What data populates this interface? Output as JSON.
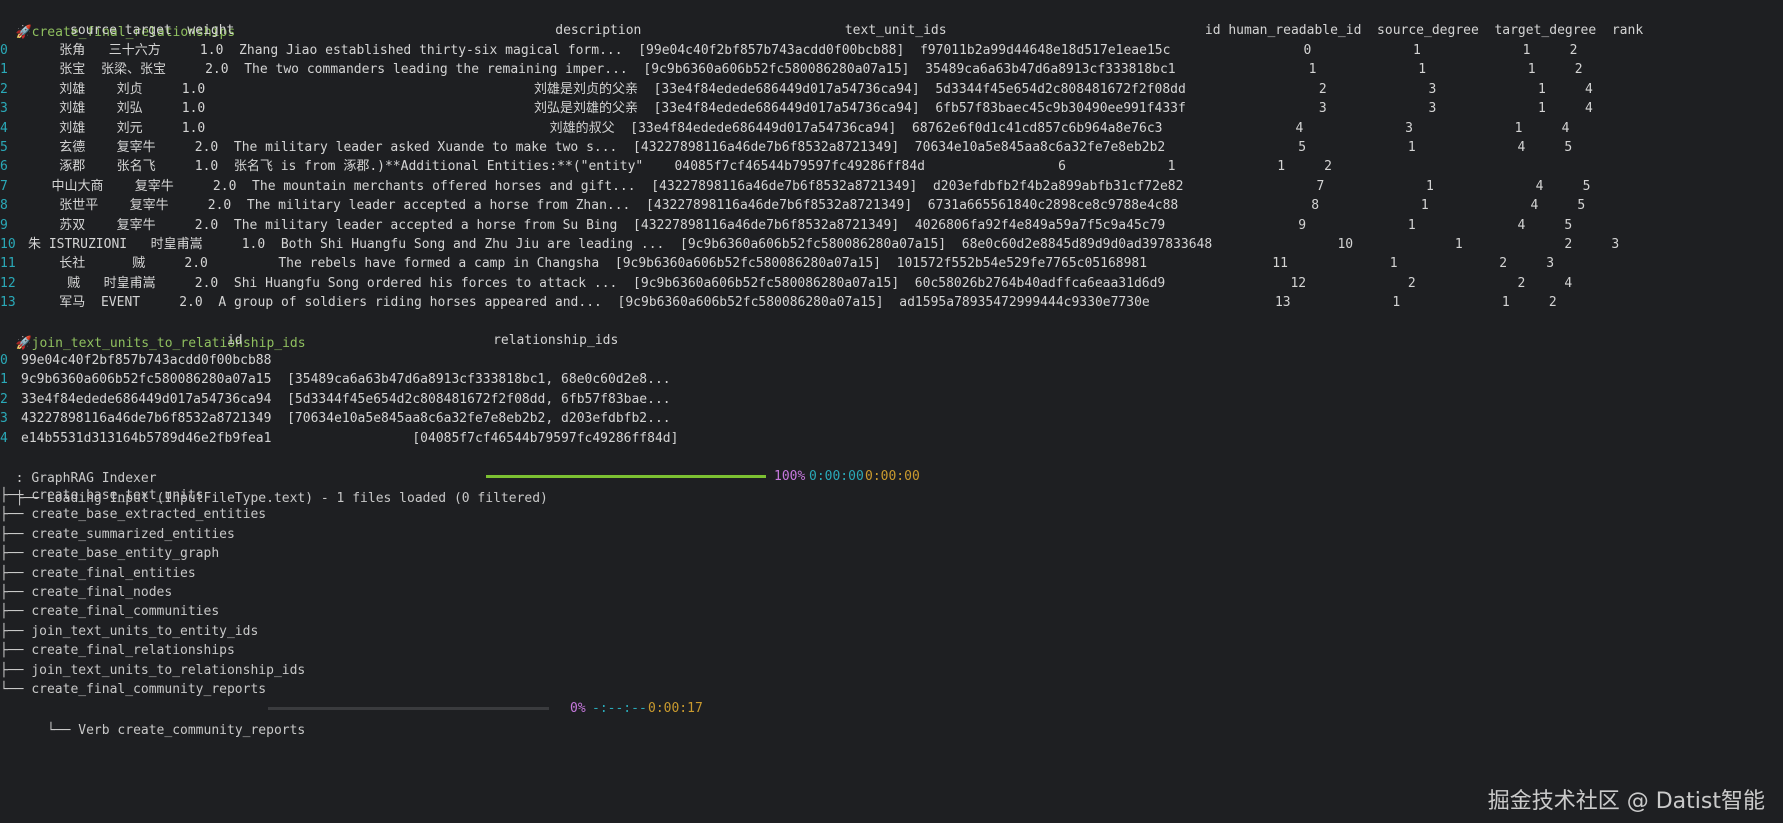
{
  "sections": {
    "relationships_title": "create_final_relationships",
    "relationships_header": "source target  weight                                         description                          text_unit_ids                                 id human_readable_id  source_degree  target_degree  rank",
    "relationship_rows": [
      {
        "idx": "0",
        "text": "    张角   三十六方     1.0  Zhang Jiao established thirty-six magical form...  [99e04c40f2bf857b743acdd0f00bcb88]  f97011b2a99d44648e18d517e1eae15c                 0             1             1     2"
      },
      {
        "idx": "1",
        "text": "    张宝  张梁、张宝     2.0  The two commanders leading the remaining imper...  [9c9b6360a606b52fc580086280a07a15]  35489ca6a63b47d6a8913cf333818bc1                 1             1             1     2"
      },
      {
        "idx": "2",
        "text": "    刘雄    刘贞     1.0                                          刘雄是刘贞的父亲  [33e4f84edede686449d017a54736ca94]  5d3344f45e654d2c808481672f2f08dd                 2             3             1     4"
      },
      {
        "idx": "3",
        "text": "    刘雄    刘弘     1.0                                          刘弘是刘雄的父亲  [33e4f84edede686449d017a54736ca94]  6fb57f83baec45c9b30490ee991f433f                 3             3             1     4"
      },
      {
        "idx": "4",
        "text": "    刘雄    刘元     1.0                                            刘雄的叔父  [33e4f84edede686449d017a54736ca94]  68762e6f0d1c41cd857c6b964a8e76c3                 4             3             1     4"
      },
      {
        "idx": "5",
        "text": "    玄德    复宰牛     2.0  The military leader asked Xuande to make two s...  [43227898116a46de7b6f8532a8721349]  70634e10a5e845aa8c6a32fe7e8eb2b2                 5             1             4     5"
      },
      {
        "idx": "6",
        "text": "    涿郡    张名飞     1.0  张名飞 is from 涿郡.)**Additional Entities:**(\"entity\"    04085f7cf46544b79597fc49286ff84d                 6             1             1     2"
      },
      {
        "idx": "7",
        "text": "   中山大商    复宰牛     2.0  The mountain merchants offered horses and gift...  [43227898116a46de7b6f8532a8721349]  d203efdbfb2f4b2a899abfb31cf72e82                 7             1             4     5"
      },
      {
        "idx": "8",
        "text": "    张世平    复宰牛     2.0  The military leader accepted a horse from Zhan...  [43227898116a46de7b6f8532a8721349]  6731a665561840c2898ce8c9788e4c88                 8             1             4     5"
      },
      {
        "idx": "9",
        "text": "    苏双    复宰牛     2.0  The military leader accepted a horse from Su Bing  [43227898116a46de7b6f8532a8721349]  4026806fa92f4e849a59a7f5c9a45c79                 9             1             4     5"
      },
      {
        "idx": "10",
        "text": "朱 ISTRUZIONI   时皇甫嵩     1.0  Both Shi Huangfu Song and Zhu Jiu are leading ...  [9c9b6360a606b52fc580086280a07a15]  68e0c60d2e8845d89d9d0ad397833648                10             1             2     3"
      },
      {
        "idx": "11",
        "text": "    长社      贼     2.0         The rebels have formed a camp in Changsha  [9c9b6360a606b52fc580086280a07a15]  101572f552b54e529fe7765c05168981                11             1             2     3"
      },
      {
        "idx": "12",
        "text": "     贼   时皇甫嵩     2.0  Shi Huangfu Song ordered his forces to attack ...  [9c9b6360a606b52fc580086280a07a15]  60c58026b2764b40adffca6eaa31d6d9                12             2             2     4"
      },
      {
        "idx": "13",
        "text": "    军马  EVENT     2.0  A group of soldiers riding horses appeared and...  [9c9b6360a606b52fc580086280a07a15]  ad1595a78935472999444c9330e7730e                13             1             1     2"
      }
    ],
    "join_title": "join_text_units_to_relationship_ids",
    "join_header": "                             id                                relationship_ids",
    "join_rows": [
      {
        "idx": "0",
        "text": "99e04c40f2bf857b743acdd0f00bcb88"
      },
      {
        "idx": "1",
        "text": "9c9b6360a606b52fc580086280a07a15  [35489ca6a63b47d6a8913cf333818bc1, 68e0c60d2e8..."
      },
      {
        "idx": "2",
        "text": "33e4f84edede686449d017a54736ca94  [5d3344f45e654d2c808481672f2f08dd, 6fb57f83bae..."
      },
      {
        "idx": "3",
        "text": "43227898116a46de7b6f8532a8721349  [70634e10a5e845aa8c6a32fe7e8eb2b2, d203efdbfb2..."
      },
      {
        "idx": "4",
        "text": "e14b5531d313164b5789d46e2fb9fea1                  [04085f7cf46544b79597fc49286ff84d]"
      }
    ]
  },
  "indexer": {
    "title": "GraphRAG Indexer",
    "loading_label": "Loading Input (InputFileType.text) - 1 files loaded (0 filtered)",
    "loading_progress": 1.0,
    "loading_percent": "100%",
    "loading_elapsed": "0:00:00",
    "loading_remaining": "0:00:00",
    "steps": [
      "create_base_text_units",
      "create_base_extracted_entities",
      "create_summarized_entities",
      "create_base_entity_graph",
      "create_final_entities",
      "create_final_nodes",
      "create_final_communities",
      "join_text_units_to_entity_ids",
      "create_final_relationships",
      "join_text_units_to_relationship_ids",
      "create_final_community_reports"
    ],
    "verb_label": "Verb create_community_reports",
    "verb_progress": 0.0,
    "verb_percent": "0%",
    "verb_eta": "-:--:--",
    "verb_elapsed": "0:00:17"
  },
  "watermark": "掘金技术社区 @ Datist智能"
}
